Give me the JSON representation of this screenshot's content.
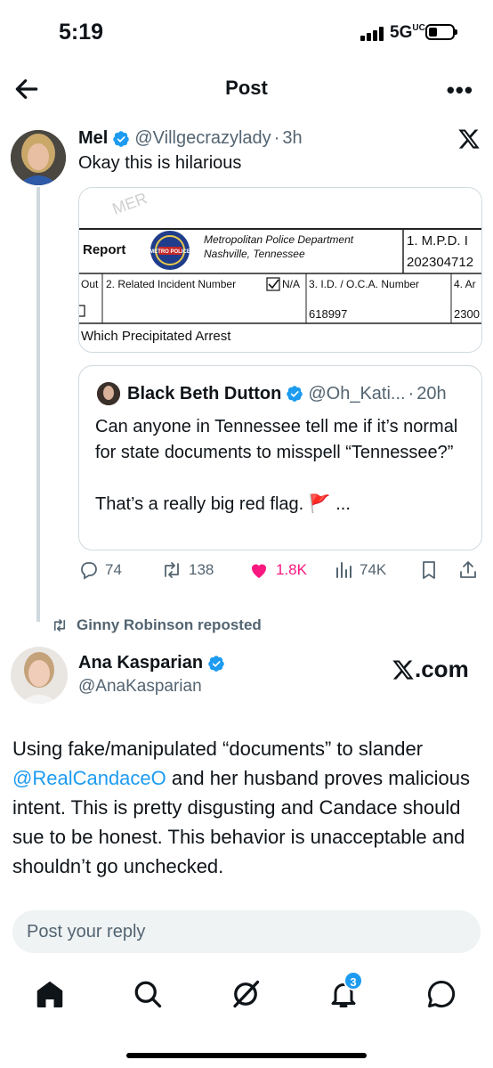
{
  "status_bar": {
    "time": "5:19",
    "network": "5G",
    "network_suffix": "UC"
  },
  "header": {
    "title": "Post",
    "back_icon": "arrow-left-icon",
    "more_icon": "more-dots-icon",
    "more_label": "•••"
  },
  "post": {
    "author_name": "Mel",
    "author_handle": "@Villgecrazylady",
    "separator": "·",
    "time": "3h",
    "text": "Okay this is hilarious",
    "image": {
      "dept_line1": "Metropolitan Police Department",
      "dept_line2": "Nashville, Tennessee",
      "report_label": "Report",
      "mpd_label": "1. M.P.D. I",
      "mpd_number": "202304712",
      "col_out": "Out",
      "col_related": "2. Related Incident Number",
      "col_na": "N/A",
      "col_id": "3. I.D. / O.C.A. Number",
      "col_4": "4. Ar",
      "id_value": "618997",
      "col4_value": "2300",
      "bottom_text": "Which Precipitated Arrest",
      "seal_text": "METRO POLICE",
      "watermark": "MER"
    },
    "quote": {
      "author_name": "Black Beth Dutton",
      "author_handle": "@Oh_Kati...",
      "separator": "·",
      "time": "20h",
      "text_line1": "Can anyone in Tennessee tell me if it’s normal for state documents to misspell “Tennessee?”",
      "text_line2": "That’s a really big red flag. 🚩 ..."
    },
    "actions": {
      "replies": "74",
      "reposts": "138",
      "likes": "1.8K",
      "views": "74K"
    }
  },
  "repost": {
    "reposted_by": "Ginny Robinson reposted",
    "author_name": "Ana Kasparian",
    "author_handle": "@AnaKasparian",
    "source": ".com",
    "text_before": "Using fake/manipulated “documents” to slander ",
    "mention": "@RealCandaceO",
    "text_after": " and her husband proves malicious intent. This is pretty disgusting and Candace should sue to be honest. This behavior is unacceptable and shouldn’t go unchecked."
  },
  "reply": {
    "placeholder": "Post your reply"
  },
  "nav": {
    "items": [
      "home-icon",
      "search-icon",
      "grok-icon",
      "notifications-icon",
      "messages-icon"
    ],
    "notifications_badge": "3"
  },
  "colors": {
    "accent": "#1d9bf0",
    "like": "#f91880",
    "secondary": "#536471",
    "border": "#cfd9de"
  }
}
